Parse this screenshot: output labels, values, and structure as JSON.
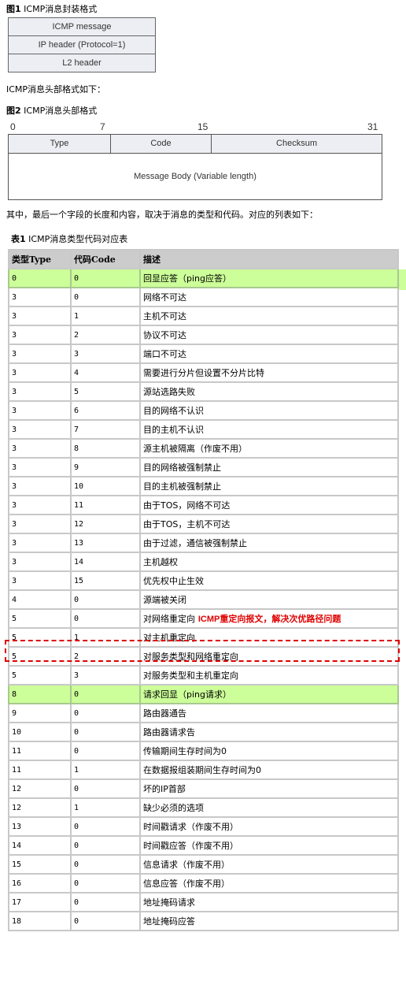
{
  "figure1": {
    "caption_label": "图1",
    "caption_text": "ICMP消息封装格式",
    "layers": [
      "ICMP message",
      "IP header (Protocol=1)",
      "L2 header"
    ]
  },
  "para1": "ICMP消息头部格式如下：",
  "figure2": {
    "caption_label": "图2",
    "caption_text": "ICMP消息头部格式",
    "bit_marks": [
      "0",
      "7",
      "15",
      "31"
    ],
    "fields": [
      "Type",
      "Code",
      "Checksum"
    ],
    "body": "Message Body (Variable length)"
  },
  "para2": "其中，最后一个字段的长度和内容，取决于消息的类型和代码。对应的列表如下：",
  "table": {
    "caption_label": "表1",
    "caption_text": "ICMP消息类型代码对应表",
    "headers": [
      "类型Type",
      "代码Code",
      "描述"
    ],
    "highlight_color": "#ccff99",
    "annotation_color": "#e00000",
    "annotation": {
      "prefix": "ICMP",
      "text": "重定向报文，解决次优路径问题"
    },
    "rows": [
      {
        "type": "0",
        "code": "0",
        "desc": "回显应答（ping应答）",
        "highlight": true
      },
      {
        "type": "3",
        "code": "0",
        "desc": "网络不可达"
      },
      {
        "type": "3",
        "code": "1",
        "desc": "主机不可达"
      },
      {
        "type": "3",
        "code": "2",
        "desc": "协议不可达"
      },
      {
        "type": "3",
        "code": "3",
        "desc": "端口不可达"
      },
      {
        "type": "3",
        "code": "4",
        "desc": "需要进行分片但设置不分片比特"
      },
      {
        "type": "3",
        "code": "5",
        "desc": "源站选路失败"
      },
      {
        "type": "3",
        "code": "6",
        "desc": "目的网络不认识"
      },
      {
        "type": "3",
        "code": "7",
        "desc": "目的主机不认识"
      },
      {
        "type": "3",
        "code": "8",
        "desc": "源主机被隔离（作废不用）"
      },
      {
        "type": "3",
        "code": "9",
        "desc": "目的网络被强制禁止"
      },
      {
        "type": "3",
        "code": "10",
        "desc": "目的主机被强制禁止"
      },
      {
        "type": "3",
        "code": "11",
        "desc": "由于TOS，网络不可达"
      },
      {
        "type": "3",
        "code": "12",
        "desc": "由于TOS，主机不可达"
      },
      {
        "type": "3",
        "code": "13",
        "desc": "由于过滤，通信被强制禁止"
      },
      {
        "type": "3",
        "code": "14",
        "desc": "主机越权"
      },
      {
        "type": "3",
        "code": "15",
        "desc": "优先权中止生效"
      },
      {
        "type": "4",
        "code": "0",
        "desc": "源端被关闭"
      },
      {
        "type": "5",
        "code": "0",
        "desc": "对网络重定向",
        "annotated": true
      },
      {
        "type": "5",
        "code": "1",
        "desc": "对主机重定向"
      },
      {
        "type": "5",
        "code": "2",
        "desc": "对服务类型和网络重定向"
      },
      {
        "type": "5",
        "code": "3",
        "desc": "对服务类型和主机重定向"
      },
      {
        "type": "8",
        "code": "0",
        "desc": "请求回显（ping请求）",
        "highlight": true
      },
      {
        "type": "9",
        "code": "0",
        "desc": "路由器通告"
      },
      {
        "type": "10",
        "code": "0",
        "desc": "路由器请求告"
      },
      {
        "type": "11",
        "code": "0",
        "desc": "传输期间生存时间为0"
      },
      {
        "type": "11",
        "code": "1",
        "desc": "在数据报组装期间生存时间为0"
      },
      {
        "type": "12",
        "code": "0",
        "desc": "坏的IP首部"
      },
      {
        "type": "12",
        "code": "1",
        "desc": "缺少必须的选项"
      },
      {
        "type": "13",
        "code": "0",
        "desc": "时间戳请求（作废不用）"
      },
      {
        "type": "14",
        "code": "0",
        "desc": "时间戳应答（作废不用）"
      },
      {
        "type": "15",
        "code": "0",
        "desc": "信息请求（作废不用）"
      },
      {
        "type": "16",
        "code": "0",
        "desc": "信息应答（作废不用）"
      },
      {
        "type": "17",
        "code": "0",
        "desc": "地址掩码请求"
      },
      {
        "type": "18",
        "code": "0",
        "desc": "地址掩码应答"
      }
    ]
  }
}
